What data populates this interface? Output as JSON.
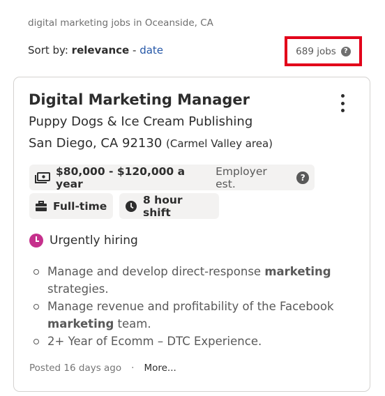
{
  "search": {
    "query_text": "digital marketing jobs in Oceanside, CA",
    "sort_prefix": "Sort by:",
    "sort_active": "relevance",
    "sort_separator": "-",
    "sort_alt": "date",
    "job_count": "689 jobs",
    "help_glyph": "?"
  },
  "job": {
    "title": "Digital Marketing Manager",
    "company": "Puppy Dogs & Ice Cream Publishing",
    "location": "San Diego, CA 92130",
    "location_area": "(Carmel Valley area)",
    "salary": "$80,000 - $120,000 a year",
    "salary_note": "Employer est.",
    "job_type": "Full-time",
    "shift": "8 hour shift",
    "urgent": "Urgently hiring",
    "bullets": [
      {
        "pre": "Manage and develop direct-response ",
        "bold": "marketing",
        "post": " strategies."
      },
      {
        "pre": "Manage revenue and profitability of the Facebook ",
        "bold": "marketing",
        "post": " team."
      },
      {
        "pre": "2+ Year of Ecomm – DTC Experience.",
        "bold": "",
        "post": ""
      }
    ],
    "posted": "Posted 16 days ago",
    "dot": "·",
    "more": "More..."
  },
  "icons": {
    "salary": "money-icon",
    "job_type": "briefcase-icon",
    "shift": "clock-icon",
    "urgent": "urgent-clock-icon",
    "menu": "kebab-menu-icon"
  },
  "colors": {
    "link": "#2557a7",
    "highlight_box": "#e2001a",
    "urgent": "#c5308c",
    "pill_bg": "#f3f2f1"
  }
}
